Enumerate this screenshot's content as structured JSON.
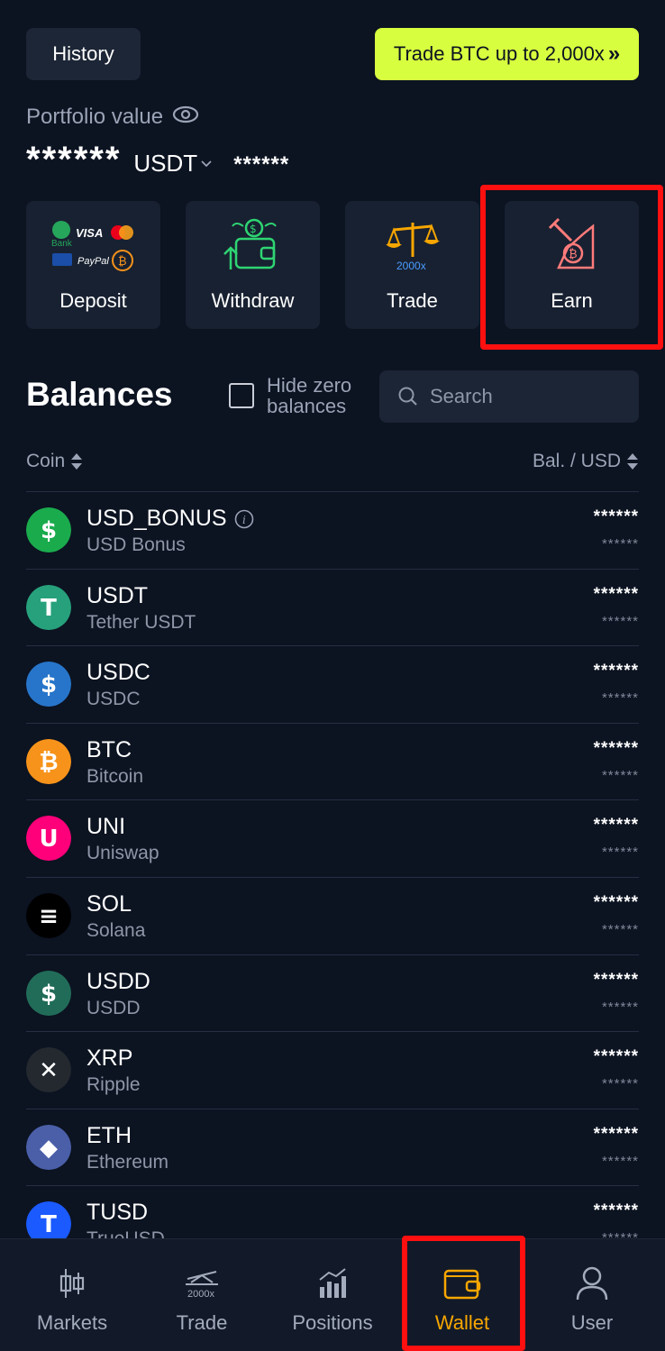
{
  "header": {
    "history_label": "History",
    "promo_label": "Trade BTC up to 2,000x"
  },
  "portfolio": {
    "label": "Portfolio value",
    "value_masked": "******",
    "currency": "USDT",
    "sub_value_masked": "******"
  },
  "actions": [
    {
      "label": "Deposit",
      "icon": "deposit-payment-icon"
    },
    {
      "label": "Withdraw",
      "icon": "withdraw-wallet-icon"
    },
    {
      "label": "Trade",
      "icon": "trade-scale-icon",
      "icon_text": "2000x"
    },
    {
      "label": "Earn",
      "icon": "earn-mining-icon"
    }
  ],
  "deposit_icon_texts": [
    "Bank",
    "VISA",
    "PayPal"
  ],
  "balances": {
    "title": "Balances",
    "hide_zero_label": "Hide zero balances",
    "search_placeholder": "Search",
    "col_coin": "Coin",
    "col_balance": "Bal. / USD"
  },
  "coins": [
    {
      "symbol": "USD_BONUS",
      "name": "USD Bonus",
      "balance": "******",
      "usd": "******",
      "color": "#1aab4d",
      "glyph": "$",
      "info": true
    },
    {
      "symbol": "USDT",
      "name": "Tether USDT",
      "balance": "******",
      "usd": "******",
      "color": "#26a17b",
      "glyph": "T"
    },
    {
      "symbol": "USDC",
      "name": "USDC",
      "balance": "******",
      "usd": "******",
      "color": "#2775ca",
      "glyph": "$"
    },
    {
      "symbol": "BTC",
      "name": "Bitcoin",
      "balance": "******",
      "usd": "******",
      "color": "#f7931a",
      "glyph": "₿"
    },
    {
      "symbol": "UNI",
      "name": "Uniswap",
      "balance": "******",
      "usd": "******",
      "color": "#ff007a",
      "glyph": "U"
    },
    {
      "symbol": "SOL",
      "name": "Solana",
      "balance": "******",
      "usd": "******",
      "color": "#000000",
      "glyph": "≡"
    },
    {
      "symbol": "USDD",
      "name": "USDD",
      "balance": "******",
      "usd": "******",
      "color": "#216c58",
      "glyph": "$"
    },
    {
      "symbol": "XRP",
      "name": "Ripple",
      "balance": "******",
      "usd": "******",
      "color": "#23292f",
      "glyph": "✕"
    },
    {
      "symbol": "ETH",
      "name": "Ethereum",
      "balance": "******",
      "usd": "******",
      "color": "#4a5fa8",
      "glyph": "◆"
    },
    {
      "symbol": "TUSD",
      "name": "TrueUSD",
      "balance": "******",
      "usd": "******",
      "color": "#1a5aff",
      "glyph": "T"
    }
  ],
  "nav": {
    "items": [
      {
        "label": "Markets",
        "icon": "candlestick-icon"
      },
      {
        "label": "Trade",
        "icon": "trade-2000x-icon",
        "icon_text": "2000x"
      },
      {
        "label": "Positions",
        "icon": "bar-chart-icon"
      },
      {
        "label": "Wallet",
        "icon": "wallet-icon",
        "active": true
      },
      {
        "label": "User",
        "icon": "user-icon"
      }
    ]
  },
  "colors": {
    "background": "#0c1321",
    "promo": "#d8ff3f",
    "active_nav": "#f7a600",
    "highlight": "#ff1010"
  }
}
